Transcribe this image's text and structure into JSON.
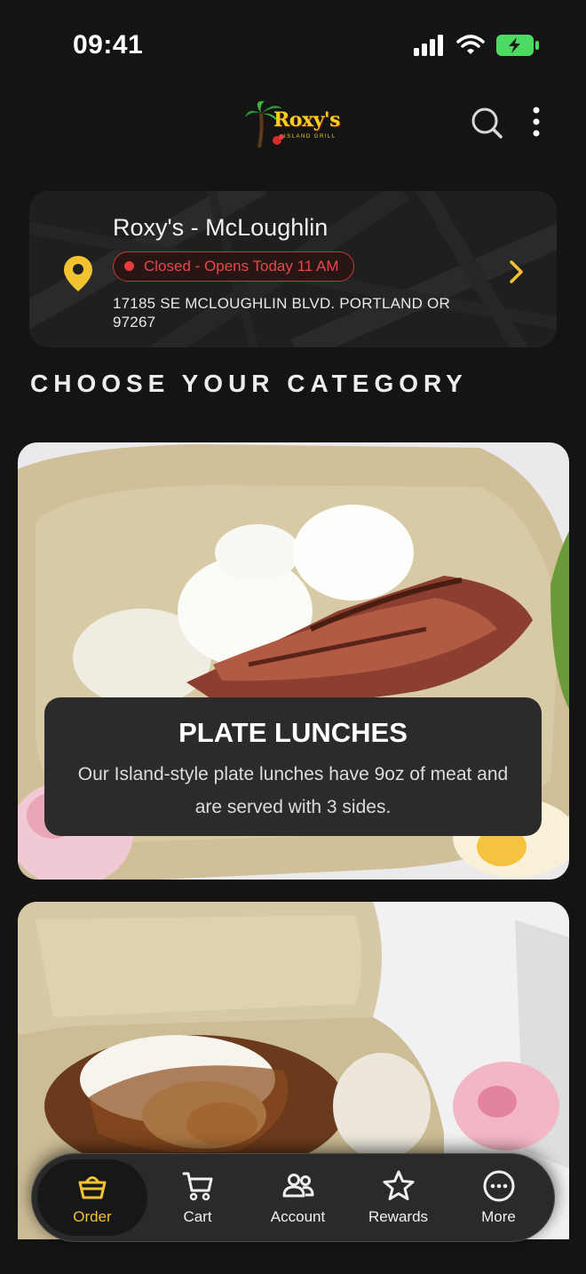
{
  "status_bar": {
    "time": "09:41",
    "icons": [
      "signal-icon",
      "wifi-icon",
      "battery-charging-icon"
    ]
  },
  "header": {
    "logo_text": "Roxy's",
    "logo_subtext": "ISLAND GRILL",
    "icons": [
      "search-icon",
      "more-vertical-icon"
    ]
  },
  "store": {
    "name": "Roxy's - McLoughlin",
    "status": "Closed - Opens Today 11 AM",
    "address": "17185 SE MCLOUGHLIN BLVD. PORTLAND OR 97267",
    "icons": [
      "location-pin-icon",
      "chevron-right-icon"
    ]
  },
  "section": {
    "heading": "CHOOSE YOUR CATEGORY"
  },
  "categories": [
    {
      "title": "PLATE LUNCHES",
      "description": "Our Island-style plate lunches have 9oz of meat and are served with 3 sides."
    }
  ],
  "tabs": [
    {
      "label": "Order",
      "icon": "basket-icon",
      "active": true
    },
    {
      "label": "Cart",
      "icon": "cart-icon",
      "active": false
    },
    {
      "label": "Account",
      "icon": "users-icon",
      "active": false
    },
    {
      "label": "Rewards",
      "icon": "star-icon",
      "active": false
    },
    {
      "label": "More",
      "icon": "more-circle-icon",
      "active": false
    }
  ],
  "colors": {
    "background": "#141414",
    "accent": "#f2c230",
    "closed_red": "#e24a4a"
  }
}
